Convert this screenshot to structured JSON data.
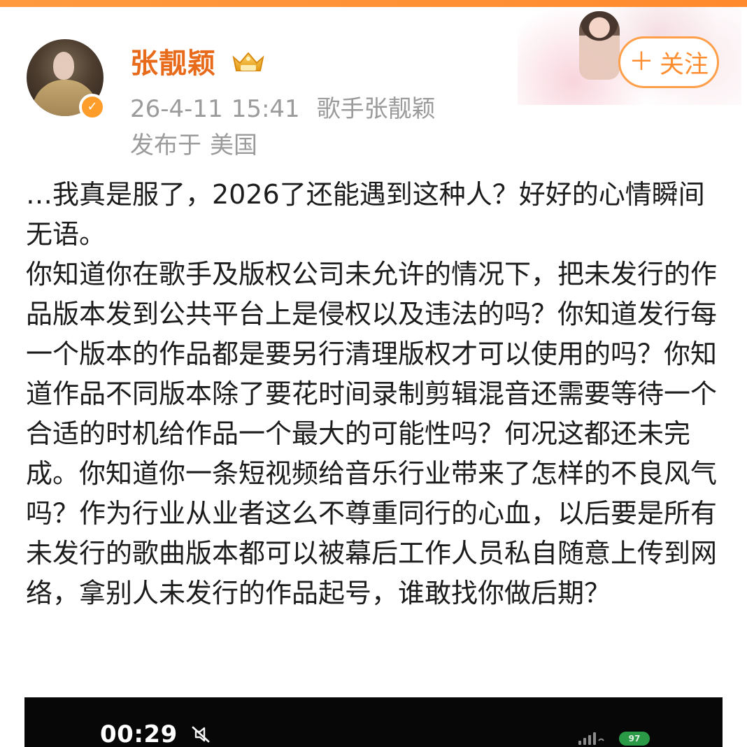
{
  "header": {
    "username": "张靓颖",
    "date": "26-4-11",
    "time": "15:41",
    "source": "歌手张靓颖",
    "posted_prefix": "发布于",
    "location": "美国",
    "follow_label": "关注"
  },
  "post": {
    "text": "…我真是服了，2026了还能遇到这种人？好好的心情瞬间无语。\n你知道你在歌手及版权公司未允许的情况下，把未发行的作品版本发到公共平台上是侵权以及违法的吗？你知道发行每一个版本的作品都是要另行清理版权才可以使用的吗？你知道作品不同版本除了要花时间录制剪辑混音还需要等待一个合适的时机给作品一个最大的可能性吗？何况这都还未完成。你知道你一条短视频给音乐行业带来了怎样的不良风气吗？作为行业从业者这么不尊重同行的心血，以后要是所有未发行的歌曲版本都可以被幕后工作人员私自随意上传到网络，拿别人未发行的作品起号，谁敢找你做后期？"
  },
  "media": {
    "clock": "00:29",
    "battery": "97"
  },
  "icons": {
    "verified": "verified-badge-icon",
    "crown": "crown-badge-icon",
    "follow_plus": "plus-icon",
    "mute": "mute-icon",
    "signal": "signal-icon"
  },
  "colors": {
    "accent_orange": "#ff8d2f",
    "username_orange": "#e86b1b",
    "meta_gray": "#9b9b9b",
    "text_dark": "#1c1c1c"
  }
}
